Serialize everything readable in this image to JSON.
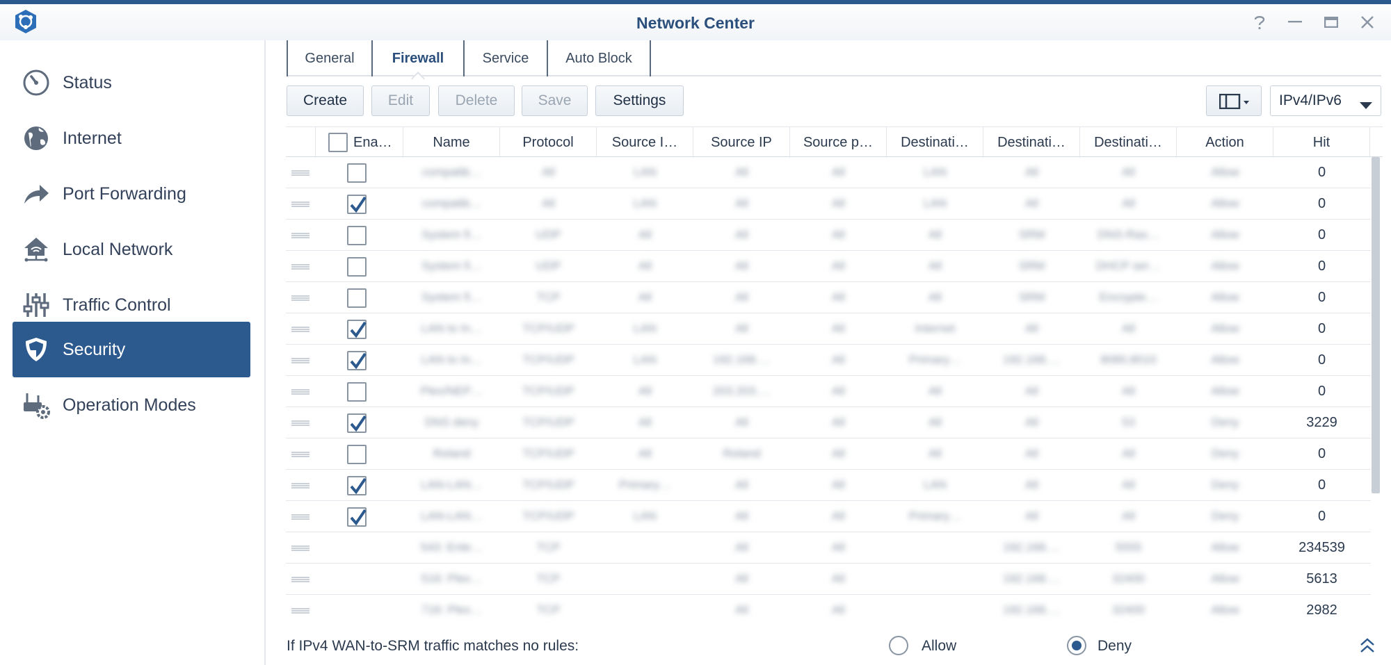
{
  "window": {
    "title": "Network Center",
    "controls": [
      "help-icon",
      "minimize-icon",
      "maximize-icon",
      "close-icon"
    ]
  },
  "sidebar": {
    "items": [
      {
        "label": "Status",
        "icon": "gauge-icon",
        "active": false
      },
      {
        "label": "Internet",
        "icon": "globe-icon",
        "active": false
      },
      {
        "label": "Port Forwarding",
        "icon": "forward-arrow-icon",
        "active": false
      },
      {
        "label": "Local Network",
        "icon": "home-network-icon",
        "active": false
      },
      {
        "label": "Traffic Control",
        "icon": "sliders-icon",
        "active": false
      },
      {
        "label": "Security",
        "icon": "shield-icon",
        "active": true
      },
      {
        "label": "Operation Modes",
        "icon": "router-gear-icon",
        "active": false
      }
    ]
  },
  "tabs": [
    {
      "label": "General",
      "active": false
    },
    {
      "label": "Firewall",
      "active": true
    },
    {
      "label": "Service",
      "active": false
    },
    {
      "label": "Auto Block",
      "active": false
    }
  ],
  "toolbar": {
    "create": "Create",
    "edit": "Edit",
    "delete": "Delete",
    "save": "Save",
    "settings": "Settings",
    "ip_version": "IPv4/IPv6"
  },
  "table": {
    "columns": [
      "Ena…",
      "Name",
      "Protocol",
      "Source I…",
      "Source IP",
      "Source p…",
      "Destinati…",
      "Destinati…",
      "Destinati…",
      "Action",
      "Hit"
    ],
    "rows": [
      {
        "enabled": false,
        "has_checkbox": true,
        "name": "compatib…",
        "protocol": "All",
        "source_if": "LAN",
        "source_ip": "All",
        "source_port": "All",
        "dest_if": "LAN",
        "dest_ip": "All",
        "dest_port": "All",
        "action": "Allow",
        "hit": "0"
      },
      {
        "enabled": true,
        "has_checkbox": true,
        "name": "compatib…",
        "protocol": "All",
        "source_if": "LAN",
        "source_ip": "All",
        "source_port": "All",
        "dest_if": "LAN",
        "dest_ip": "All",
        "dest_port": "All",
        "action": "Allow",
        "hit": "0"
      },
      {
        "enabled": false,
        "has_checkbox": true,
        "name": "System fi…",
        "protocol": "UDP",
        "source_if": "All",
        "source_ip": "All",
        "source_port": "All",
        "dest_if": "All",
        "dest_ip": "SRM",
        "dest_port": "DNS-Ras…",
        "action": "Allow",
        "hit": "0"
      },
      {
        "enabled": false,
        "has_checkbox": true,
        "name": "System fi…",
        "protocol": "UDP",
        "source_if": "All",
        "source_ip": "All",
        "source_port": "All",
        "dest_if": "All",
        "dest_ip": "SRM",
        "dest_port": "DHCP ser…",
        "action": "Allow",
        "hit": "0"
      },
      {
        "enabled": false,
        "has_checkbox": true,
        "name": "System fi…",
        "protocol": "TCP",
        "source_if": "All",
        "source_ip": "All",
        "source_port": "All",
        "dest_if": "All",
        "dest_ip": "SRM",
        "dest_port": "Encrypte…",
        "action": "Allow",
        "hit": "0"
      },
      {
        "enabled": true,
        "has_checkbox": true,
        "name": "LAN to In…",
        "protocol": "TCP/UDP",
        "source_if": "LAN",
        "source_ip": "All",
        "source_port": "All",
        "dest_if": "Internet",
        "dest_ip": "All",
        "dest_port": "All",
        "action": "Allow",
        "hit": "0"
      },
      {
        "enabled": true,
        "has_checkbox": true,
        "name": "LAN to In…",
        "protocol": "TCP/UDP",
        "source_if": "LAN",
        "source_ip": "192.168.…",
        "source_port": "All",
        "dest_if": "Primary…",
        "dest_ip": "192.168.…",
        "dest_port": "8080,8010",
        "action": "Allow",
        "hit": "0"
      },
      {
        "enabled": false,
        "has_checkbox": true,
        "name": "Plex/NEP…",
        "protocol": "TCP/UDP",
        "source_if": "All",
        "source_ip": "203.203.…",
        "source_port": "All",
        "dest_if": "All",
        "dest_ip": "All",
        "dest_port": "All",
        "action": "Allow",
        "hit": "0"
      },
      {
        "enabled": true,
        "has_checkbox": true,
        "name": "DNS deny",
        "protocol": "TCP/UDP",
        "source_if": "All",
        "source_ip": "All",
        "source_port": "All",
        "dest_if": "All",
        "dest_ip": "All",
        "dest_port": "53",
        "action": "Deny",
        "hit": "3229"
      },
      {
        "enabled": false,
        "has_checkbox": true,
        "name": "Roland",
        "protocol": "TCP/UDP",
        "source_if": "All",
        "source_ip": "Roland",
        "source_port": "All",
        "dest_if": "All",
        "dest_ip": "All",
        "dest_port": "All",
        "action": "Deny",
        "hit": "0"
      },
      {
        "enabled": true,
        "has_checkbox": true,
        "name": "LAN-LAN…",
        "protocol": "TCP/UDP",
        "source_if": "Primary…",
        "source_ip": "All",
        "source_port": "All",
        "dest_if": "LAN",
        "dest_ip": "All",
        "dest_port": "All",
        "action": "Deny",
        "hit": "0"
      },
      {
        "enabled": true,
        "has_checkbox": true,
        "name": "LAN-LAN…",
        "protocol": "TCP/UDP",
        "source_if": "LAN",
        "source_ip": "All",
        "source_port": "All",
        "dest_if": "Primary…",
        "dest_ip": "All",
        "dest_port": "All",
        "action": "Deny",
        "hit": "0"
      },
      {
        "enabled": false,
        "has_checkbox": false,
        "name": "543: Ente…",
        "protocol": "TCP",
        "source_if": "",
        "source_ip": "All",
        "source_port": "All",
        "dest_if": "",
        "dest_ip": "192.168.…",
        "dest_port": "5555",
        "action": "Allow",
        "hit": "234539"
      },
      {
        "enabled": false,
        "has_checkbox": false,
        "name": "516: Plex…",
        "protocol": "TCP",
        "source_if": "",
        "source_ip": "All",
        "source_port": "All",
        "dest_if": "",
        "dest_ip": "192.168.…",
        "dest_port": "32400",
        "action": "Allow",
        "hit": "5613"
      },
      {
        "enabled": false,
        "has_checkbox": false,
        "name": "716: Plex…",
        "protocol": "TCP",
        "source_if": "",
        "source_ip": "All",
        "source_port": "All",
        "dest_if": "",
        "dest_ip": "192.168.…",
        "dest_port": "32400",
        "action": "Allow",
        "hit": "2982"
      }
    ]
  },
  "footer": {
    "label": "If IPv4 WAN-to-SRM traffic matches no rules:",
    "allow": "Allow",
    "deny": "Deny",
    "selected": "Deny"
  },
  "colors": {
    "accent": "#2c5a8f",
    "title": "#2b4f7c"
  }
}
